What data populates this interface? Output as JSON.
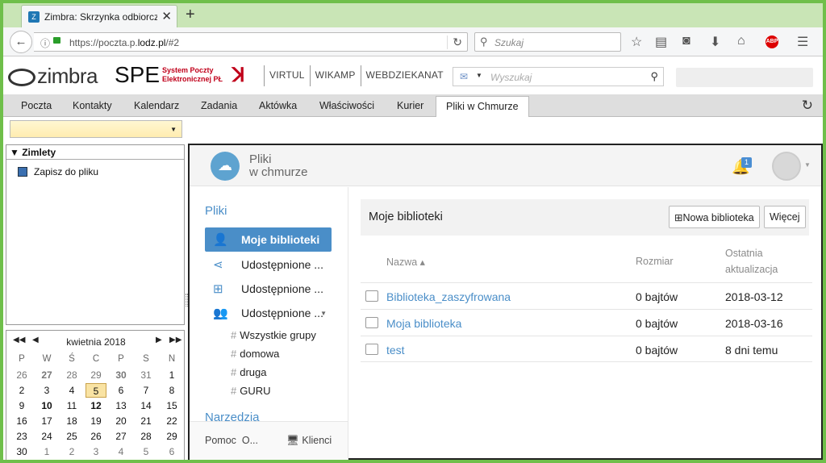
{
  "browser": {
    "tab_title": "Zimbra: Skrzynka odbiorcz...",
    "tab_favicon": "zimbra-favicon",
    "url_prefix": "https://poczta.p.",
    "url_domain": "lodz.pl",
    "url_suffix": "/#2",
    "search_placeholder": "Szukaj"
  },
  "header": {
    "logo_text": "zimbra",
    "spe": "SPE",
    "spe_sub1": "System Poczty",
    "spe_sub2": "Elektronicznej PŁ",
    "links": [
      "VIRTUL",
      "WIKAMP",
      "WEBDZIEKANAT"
    ],
    "search_placeholder": "Wyszukaj"
  },
  "app_tabs": [
    "Poczta",
    "Kontakty",
    "Kalendarz",
    "Zadania",
    "Aktówka",
    "Właściwości",
    "Kurier",
    "Pliki w Chmurze"
  ],
  "left": {
    "zimlets_header": "Zimlety",
    "zimlet_item": "Zapisz do pliku"
  },
  "calendar": {
    "month": "kwietnia 2018",
    "weekdays": [
      "P",
      "W",
      "Ś",
      "C",
      "P",
      "S",
      "N"
    ],
    "rows": [
      [
        "26",
        "27",
        "28",
        "29",
        "30",
        "31",
        "1"
      ],
      [
        "2",
        "3",
        "4",
        "5",
        "6",
        "7",
        "8"
      ],
      [
        "9",
        "10",
        "11",
        "12",
        "13",
        "14",
        "15"
      ],
      [
        "16",
        "17",
        "18",
        "19",
        "20",
        "21",
        "22"
      ],
      [
        "23",
        "24",
        "25",
        "26",
        "27",
        "28",
        "29"
      ],
      [
        "30",
        "1",
        "2",
        "3",
        "4",
        "5",
        "6"
      ]
    ],
    "today": "5"
  },
  "cloud": {
    "title1": "Pliki",
    "title2": "w chmurze",
    "notification_count": "1",
    "section_files": "Pliki",
    "nav": [
      "Moje biblioteki",
      "Udostępnione ...",
      "Udostępnione ...",
      "Udostępnione ..."
    ],
    "groups": [
      "Wszystkie grupy",
      "domowa",
      "druga",
      "GURU"
    ],
    "section_tools": "Narzedzia",
    "footer_help": "Pomoc",
    "footer_more": "O...",
    "footer_clients": "Klienci",
    "panel_title": "Moje biblioteki",
    "btn_new": "Nowa biblioteka",
    "btn_more": "Więcej",
    "col_name": "Nazwa ▴",
    "col_size": "Rozmiar",
    "col_updated_1": "Ostatnia",
    "col_updated_2": "aktualizacja",
    "rows": [
      {
        "name": "Biblioteka_zaszyfrowana",
        "size": "0 bajtów",
        "date": "2018-03-12"
      },
      {
        "name": "Moja biblioteka",
        "size": "0 bajtów",
        "date": "2018-03-16"
      },
      {
        "name": "test",
        "size": "0 bajtów",
        "date": "8 dni temu"
      }
    ]
  },
  "colors": {
    "accent": "#4a8ec8",
    "zimbra_red": "#c0001a"
  }
}
